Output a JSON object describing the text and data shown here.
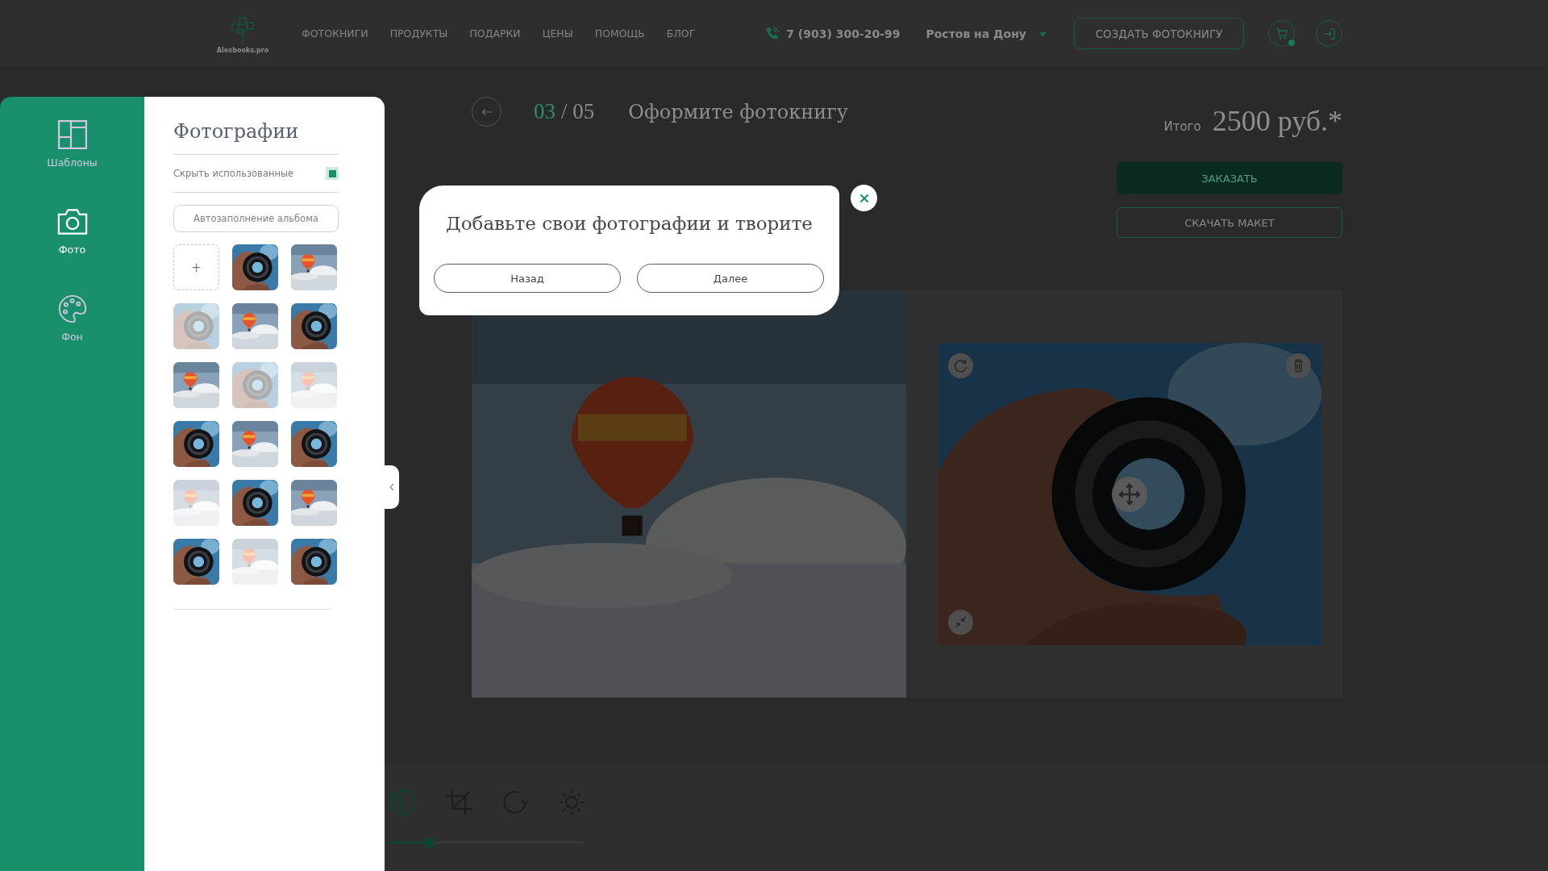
{
  "header": {
    "logo_text": "Alexbooks.pro",
    "nav": [
      "ФОТОКНИГИ",
      "ПРОДУКТЫ",
      "ПОДАРКИ",
      "ЦЕНЫ",
      "ПОМОЩЬ",
      "БЛОГ"
    ],
    "phone": "7 (903) 300-20-99",
    "city": "Ростов на Дону",
    "create_button": "СОЗДАТЬ ФОТОКНИГУ"
  },
  "sidebar": {
    "items": [
      {
        "label": "Шаблоны",
        "kind": "templates",
        "selected": false
      },
      {
        "label": "Фото",
        "kind": "photos",
        "selected": true
      },
      {
        "label": "Фон",
        "kind": "backgrounds",
        "selected": false
      }
    ]
  },
  "photos_panel": {
    "title": "Фотографии",
    "hide_used": {
      "label": "Скрыть использованные",
      "checked": true
    },
    "autofill_button": "Автозаполнение альбома",
    "add_tile": "+",
    "photos": [
      {
        "kind": "lens",
        "used": false
      },
      {
        "kind": "balloon",
        "used": false
      },
      {
        "kind": "lens",
        "used": true
      },
      {
        "kind": "balloon",
        "used": false
      },
      {
        "kind": "lens",
        "used": false
      },
      {
        "kind": "balloon",
        "used": false
      },
      {
        "kind": "lens",
        "used": true
      },
      {
        "kind": "balloon",
        "used": true
      },
      {
        "kind": "lens",
        "used": false
      },
      {
        "kind": "balloon",
        "used": false
      },
      {
        "kind": "lens",
        "used": false
      },
      {
        "kind": "balloon",
        "used": true
      },
      {
        "kind": "lens",
        "used": false
      },
      {
        "kind": "balloon",
        "used": false
      },
      {
        "kind": "lens",
        "used": false
      },
      {
        "kind": "balloon",
        "used": true
      },
      {
        "kind": "lens",
        "used": false
      }
    ]
  },
  "step": {
    "current": "03",
    "total": "/ 05",
    "title": "Оформите фотокнигу"
  },
  "summary": {
    "label": "Итого",
    "price": "2500 руб.*",
    "order_button": "ЗАКАЗАТЬ",
    "download_button": "СКАЧАТЬ МАКЕТ"
  },
  "spread": {
    "pages": [
      {
        "kind": "full",
        "photo": {
          "kind": "balloon"
        },
        "selected": false
      },
      {
        "kind": "inset",
        "photo": {
          "kind": "lens"
        },
        "selected": true
      }
    ]
  },
  "toolbar": {
    "tools": [
      {
        "kind": "contrast",
        "selected": true
      },
      {
        "kind": "crop",
        "selected": false
      },
      {
        "kind": "rotate",
        "selected": false
      },
      {
        "kind": "brightness",
        "selected": false
      }
    ],
    "slider": {
      "level": 0.19
    }
  },
  "modal": {
    "message": "Добавьте свои фотографии и творите",
    "buttons": [
      "Назад",
      "Далее"
    ]
  }
}
